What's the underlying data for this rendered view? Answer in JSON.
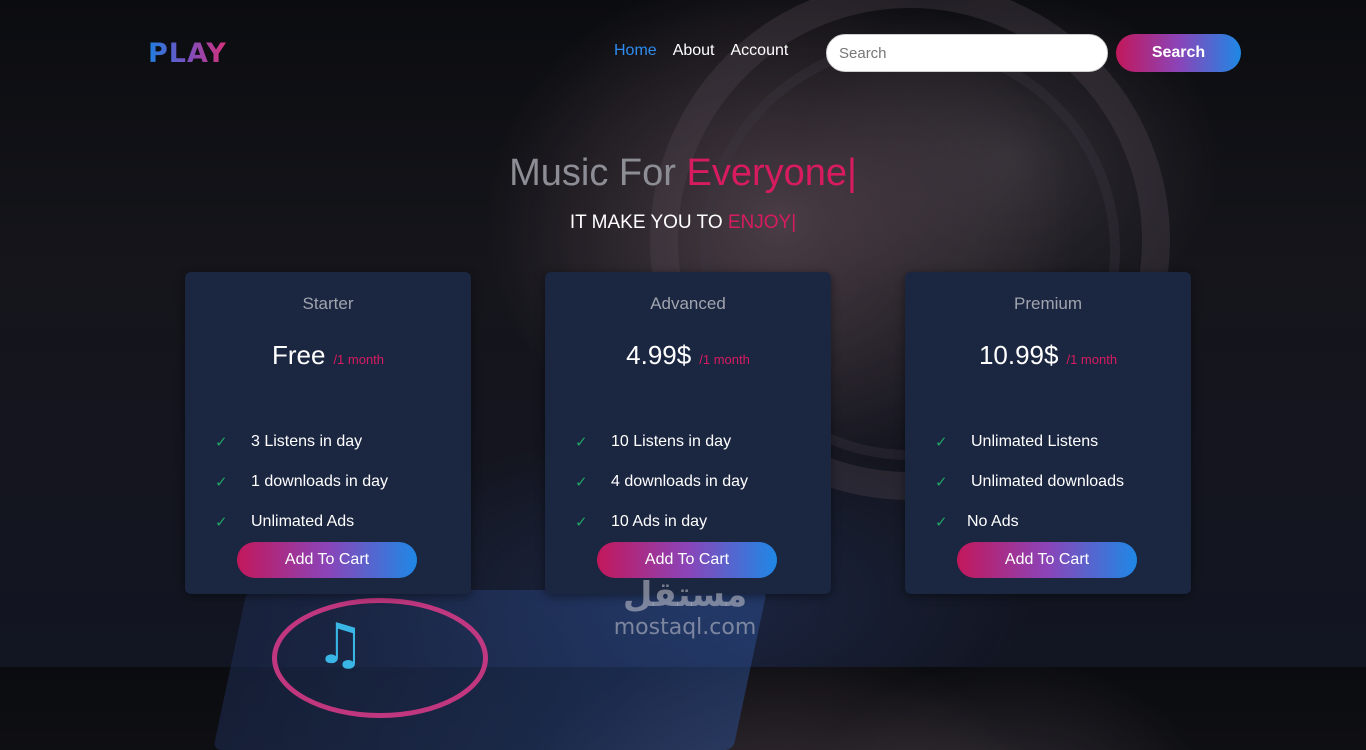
{
  "header": {
    "logo": "PLAY",
    "nav": [
      "Home",
      "About",
      "Account"
    ],
    "search_placeholder": "Search",
    "search_button": "Search"
  },
  "hero": {
    "title_prefix": "Music For ",
    "title_highlight": "Everyone|",
    "subtitle_prefix": "IT MAKE YOU TO ",
    "subtitle_highlight": "ENJOY|"
  },
  "plans": [
    {
      "name": "Starter",
      "price": "Free",
      "period": "/1 month",
      "features": [
        "3 Listens in day",
        "1 downloads in day",
        "Unlimated Ads"
      ],
      "button": "Add To Cart"
    },
    {
      "name": "Advanced",
      "price": "4.99$",
      "period": "/1 month",
      "features": [
        "10 Listens in day",
        "4 downloads in day",
        "10 Ads in day"
      ],
      "button": "Add To Cart"
    },
    {
      "name": "Premium",
      "price": "10.99$",
      "period": "/1 month",
      "features": [
        "Unlimated Listens",
        "Unlimated downloads",
        "No Ads"
      ],
      "button": "Add To Cart"
    }
  ],
  "watermark": {
    "arabic": "مستقل",
    "latin": "mostaql.com"
  },
  "colors": {
    "accent_pink": "#d81b60",
    "accent_blue": "#1e88e5",
    "card_bg": "#1b2641",
    "check_green": "#21a366"
  },
  "icons": {
    "feature_check": "check-icon",
    "background_note": "music-note-icon"
  }
}
